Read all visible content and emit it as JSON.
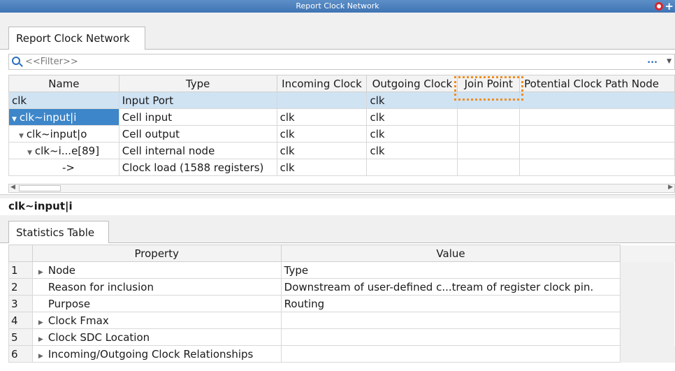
{
  "window": {
    "title": "Report Clock Network"
  },
  "tabs": {
    "top_tab": "Report Clock Network",
    "bottom_tab": "Statistics Table"
  },
  "filter": {
    "placeholder": "<<Filter>>",
    "more": "..."
  },
  "clock_table": {
    "headers": [
      "Name",
      "Type",
      "Incoming Clock",
      "Outgoing Clock",
      "Join Point",
      "Potential Clock Path Node"
    ],
    "rows": [
      {
        "name": "clk",
        "type": "Input Port",
        "incoming": "",
        "outgoing": "clk",
        "join": "",
        "potential": ""
      },
      {
        "name": "clk~input|i",
        "type": "Cell input",
        "incoming": "clk",
        "outgoing": "clk",
        "join": "",
        "potential": ""
      },
      {
        "name": "clk~input|o",
        "type": "Cell output",
        "incoming": "clk",
        "outgoing": "clk",
        "join": "",
        "potential": ""
      },
      {
        "name": "clk~i...e[89]",
        "type": "Cell internal node",
        "incoming": "clk",
        "outgoing": "clk",
        "join": "",
        "potential": ""
      },
      {
        "name": "->",
        "type": "Clock load (1588 registers)",
        "incoming": "clk",
        "outgoing": "",
        "join": "",
        "potential": ""
      }
    ]
  },
  "details": {
    "title": "clk~input|i"
  },
  "stats_table": {
    "headers": [
      "Property",
      "Value"
    ],
    "rows": [
      {
        "num": "1",
        "property": "Node",
        "value": "Type"
      },
      {
        "num": "2",
        "property": "Reason for inclusion",
        "value": "Downstream of user-defined c...tream of register clock pin."
      },
      {
        "num": "3",
        "property": "Purpose",
        "value": "Routing"
      },
      {
        "num": "4",
        "property": "Clock Fmax",
        "value": ""
      },
      {
        "num": "5",
        "property": "Clock SDC Location",
        "value": ""
      },
      {
        "num": "6",
        "property": "Incoming/Outgoing Clock Relationships",
        "value": ""
      }
    ]
  },
  "colors": {
    "highlight_border": "#f28c1f",
    "selection": "#3d86c9",
    "row_selected": "#cfe3f3"
  }
}
